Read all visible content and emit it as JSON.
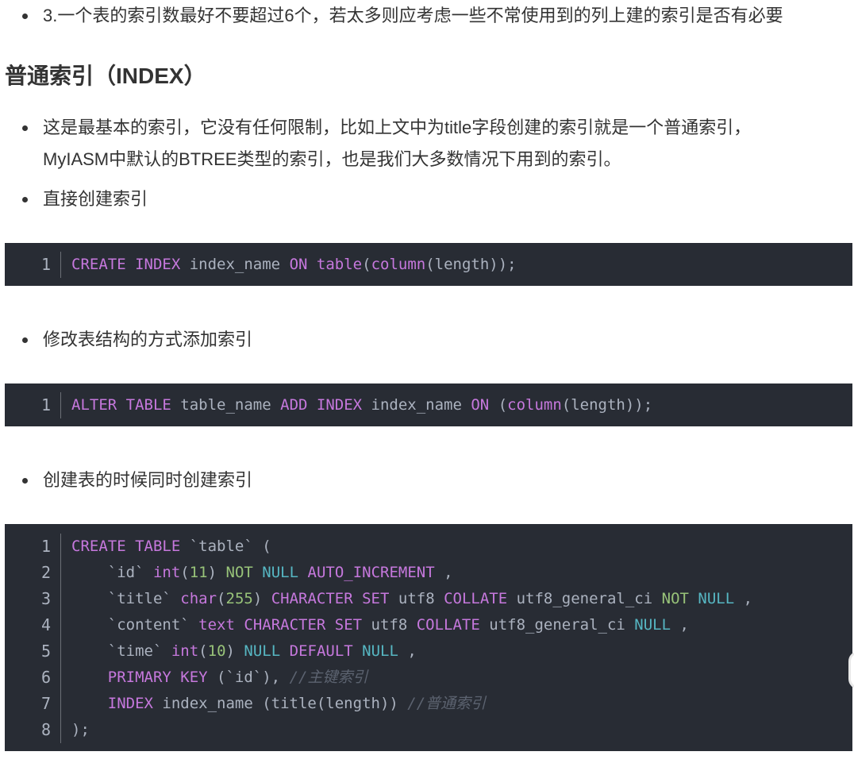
{
  "intro_bullet": "3.一个表的索引数最好不要超过6个，若太多则应考虑一些不常使用到的列上建的索引是否有必要",
  "section_heading": "普通索引（INDEX）",
  "desc_bullet": {
    "line1": "这是最基本的索引，它没有任何限制，比如上文中为title字段创建的索引就是一个普通索引，",
    "line2": "MyIASM中默认的BTREE类型的索引，也是我们大多数情况下用到的索引。"
  },
  "bullet_direct": "直接创建索引",
  "bullet_alter": "修改表结构的方式添加索引",
  "bullet_create_table": "创建表的时候同时创建索引",
  "code1": {
    "lines": [
      [
        [
          "CREATE INDEX",
          "kw"
        ],
        [
          " index_name ",
          "pl"
        ],
        [
          "ON",
          "kw"
        ],
        [
          " ",
          "pl"
        ],
        [
          "table",
          "kw"
        ],
        [
          "(",
          "pl"
        ],
        [
          "column",
          "kw"
        ],
        [
          "(length));",
          "pl"
        ]
      ]
    ]
  },
  "code2": {
    "lines": [
      [
        [
          "ALTER TABLE",
          "kw"
        ],
        [
          " table_name ",
          "pl"
        ],
        [
          "ADD INDEX",
          "kw"
        ],
        [
          " index_name ",
          "pl"
        ],
        [
          "ON",
          "kw"
        ],
        [
          " (",
          "pl"
        ],
        [
          "column",
          "kw"
        ],
        [
          "(length));",
          "pl"
        ]
      ]
    ]
  },
  "code3": {
    "lines": [
      [
        [
          "CREATE TABLE",
          "kw"
        ],
        [
          " `table` (",
          "pl"
        ]
      ],
      [
        [
          "    `id` ",
          "pl"
        ],
        [
          "int",
          "kw"
        ],
        [
          "(",
          "pl"
        ],
        [
          "11",
          "nm"
        ],
        [
          ") ",
          "pl"
        ],
        [
          "NOT",
          "gr"
        ],
        [
          " ",
          "pl"
        ],
        [
          "NULL",
          "ty"
        ],
        [
          " ",
          "pl"
        ],
        [
          "AUTO_INCREMENT",
          "kw"
        ],
        [
          " ,",
          "pl"
        ]
      ],
      [
        [
          "    `title` ",
          "pl"
        ],
        [
          "char",
          "kw"
        ],
        [
          "(",
          "pl"
        ],
        [
          "255",
          "nm"
        ],
        [
          ") ",
          "pl"
        ],
        [
          "CHARACTER SET",
          "kw"
        ],
        [
          " utf8 ",
          "pl"
        ],
        [
          "COLLATE",
          "kw"
        ],
        [
          " utf8_general_ci ",
          "pl"
        ],
        [
          "NOT",
          "gr"
        ],
        [
          " ",
          "pl"
        ],
        [
          "NULL",
          "ty"
        ],
        [
          " ,",
          "pl"
        ]
      ],
      [
        [
          "    `content` ",
          "pl"
        ],
        [
          "text",
          "kw"
        ],
        [
          " ",
          "pl"
        ],
        [
          "CHARACTER SET",
          "kw"
        ],
        [
          " utf8 ",
          "pl"
        ],
        [
          "COLLATE",
          "kw"
        ],
        [
          " utf8_general_ci ",
          "pl"
        ],
        [
          "NULL",
          "ty"
        ],
        [
          " ,",
          "pl"
        ]
      ],
      [
        [
          "    `time` ",
          "pl"
        ],
        [
          "int",
          "kw"
        ],
        [
          "(",
          "pl"
        ],
        [
          "10",
          "nm"
        ],
        [
          ") ",
          "pl"
        ],
        [
          "NULL",
          "ty"
        ],
        [
          " ",
          "pl"
        ],
        [
          "DEFAULT",
          "kw"
        ],
        [
          " ",
          "pl"
        ],
        [
          "NULL",
          "ty"
        ],
        [
          " ,",
          "pl"
        ]
      ],
      [
        [
          "    ",
          "pl"
        ],
        [
          "PRIMARY KEY",
          "kw"
        ],
        [
          " (`id`), ",
          "pl"
        ],
        [
          "//主键索引",
          "cm"
        ]
      ],
      [
        [
          "    ",
          "pl"
        ],
        [
          "INDEX",
          "kw"
        ],
        [
          " index_name (title(length)) ",
          "pl"
        ],
        [
          "//普通索引",
          "cm"
        ]
      ],
      [
        [
          ");",
          "pl"
        ]
      ]
    ]
  }
}
